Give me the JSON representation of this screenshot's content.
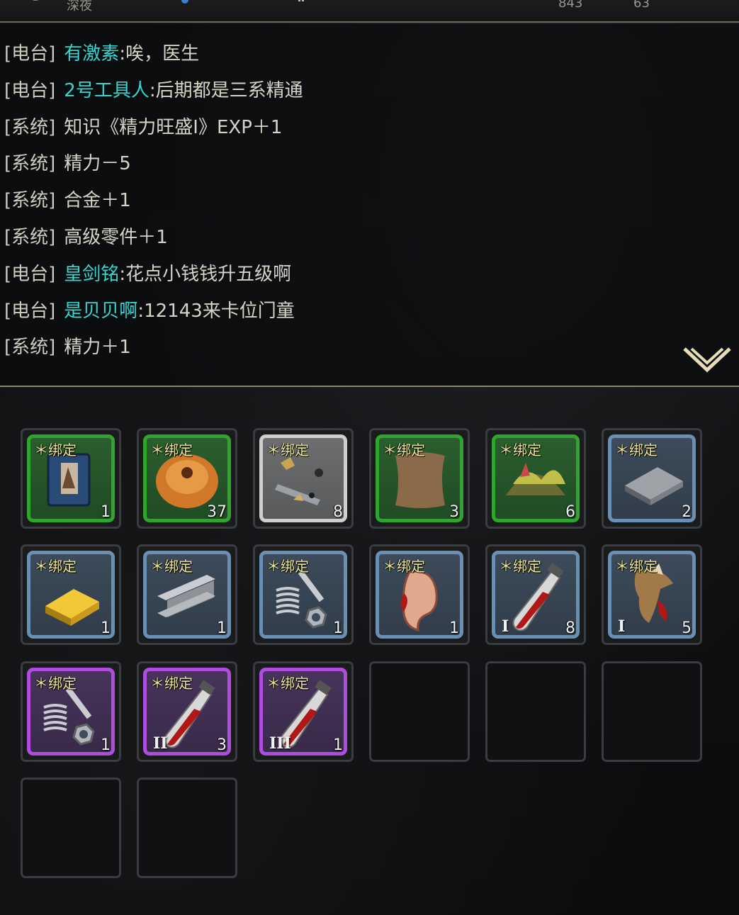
{
  "top_bar": {
    "item_1": "深夜",
    "item_2": "843",
    "item_3": "63"
  },
  "log": {
    "lines": [
      {
        "channel": "[电台]",
        "name": "有激素",
        "sep": ":",
        "text": "唉，医生"
      },
      {
        "channel": "[电台]",
        "name": "2号工具人",
        "sep": ":",
        "text": "后期都是三系精通"
      },
      {
        "channel": "[系统]",
        "name": "",
        "sep": "",
        "text": "知识《精力旺盛Ⅰ》EXP＋1"
      },
      {
        "channel": "[系统]",
        "name": "",
        "sep": "",
        "text": "精力－5"
      },
      {
        "channel": "[系统]",
        "name": "",
        "sep": "",
        "text": "合金＋1"
      },
      {
        "channel": "[系统]",
        "name": "",
        "sep": "",
        "text": "高级零件＋1"
      },
      {
        "channel": "[电台]",
        "name": "皇剑铭",
        "sep": ":",
        "text": "花点小钱钱升五级啊"
      },
      {
        "channel": "[电台]",
        "name": "是贝贝啊",
        "sep": ":",
        "text": "12143来卡位门童"
      },
      {
        "channel": "[系统]",
        "name": "",
        "sep": "",
        "text": "精力＋1"
      }
    ],
    "expand_icon": "double-chevron-down-icon"
  },
  "inventory": {
    "bind_label": "＊绑定",
    "colors": {
      "green": "#2fa52f",
      "blue": "#6b8fb3",
      "white": "#cfcfcf",
      "purple": "#b04ce0"
    },
    "items": [
      {
        "icon": "book-icon",
        "rarity": "green",
        "count": "1",
        "tier": ""
      },
      {
        "icon": "orange-sack-icon",
        "rarity": "green",
        "count": "37",
        "tier": ""
      },
      {
        "icon": "scrap-pieces-icon",
        "rarity": "white",
        "count": "8",
        "tier": ""
      },
      {
        "icon": "leather-hide-icon",
        "rarity": "green",
        "count": "3",
        "tier": ""
      },
      {
        "icon": "herb-pile-icon",
        "rarity": "green",
        "count": "6",
        "tier": ""
      },
      {
        "icon": "metal-plate-icon",
        "rarity": "blue",
        "count": "2",
        "tier": ""
      },
      {
        "icon": "gold-bar-icon",
        "rarity": "blue",
        "count": "1",
        "tier": ""
      },
      {
        "icon": "steel-beam-icon",
        "rarity": "blue",
        "count": "1",
        "tier": ""
      },
      {
        "icon": "spring-bolt-nut-icon",
        "rarity": "blue",
        "count": "1",
        "tier": ""
      },
      {
        "icon": "bloody-ear-icon",
        "rarity": "blue",
        "count": "1",
        "tier": ""
      },
      {
        "icon": "blood-vial-icon",
        "rarity": "blue",
        "count": "8",
        "tier": "I"
      },
      {
        "icon": "claw-icon",
        "rarity": "blue",
        "count": "5",
        "tier": "I"
      },
      {
        "icon": "spring-bolt-nut-icon",
        "rarity": "purple",
        "count": "1",
        "tier": ""
      },
      {
        "icon": "blood-vial-icon",
        "rarity": "purple",
        "count": "3",
        "tier": "II"
      },
      {
        "icon": "blood-vial-icon",
        "rarity": "purple",
        "count": "1",
        "tier": "III"
      }
    ],
    "empty_slots": 5
  }
}
